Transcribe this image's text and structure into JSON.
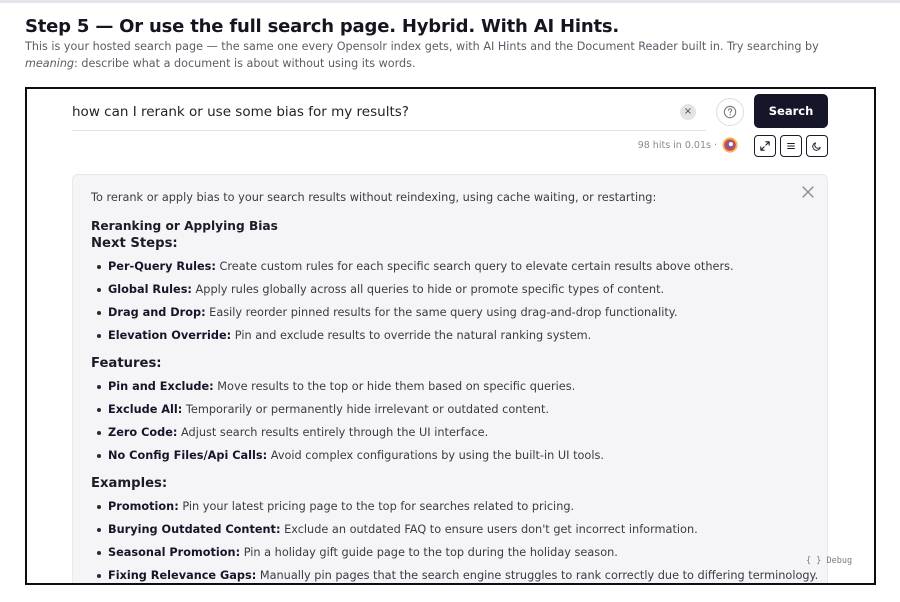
{
  "step": {
    "title": "Step 5 — Or use the full search page. Hybrid. With AI Hints.",
    "desc_before": "This is your hosted search page — the same one every Opensolr index gets, with AI Hints and the Document Reader built in. Try searching by ",
    "desc_em": "meaning",
    "desc_after": ": describe what a document is about without using its words."
  },
  "search": {
    "query": "how can I rerank or use some bias for my results?",
    "clear_icon": "×",
    "help_icon": "help-circle",
    "button_label": "Search",
    "hits_text": "98 hits in 0.01s ·"
  },
  "toolbar": {
    "expand_icon": "expand",
    "list_icon": "list",
    "theme_icon": "moon"
  },
  "ai_hint": {
    "intro": "To rerank or apply bias to your search results without reindexing, using cache waiting, or restarting:",
    "title": "Reranking or Applying Bias",
    "sections": [
      {
        "heading": "Next Steps:",
        "items": [
          {
            "term": "Per-Query Rules:",
            "text": " Create custom rules for each specific search query to elevate certain results above others."
          },
          {
            "term": "Global Rules:",
            "text": " Apply rules globally across all queries to hide or promote specific types of content."
          },
          {
            "term": "Drag and Drop:",
            "text": " Easily reorder pinned results for the same query using drag-and-drop functionality."
          },
          {
            "term": "Elevation Override:",
            "text": " Pin and exclude results to override the natural ranking system."
          }
        ]
      },
      {
        "heading": "Features:",
        "items": [
          {
            "term": "Pin and Exclude:",
            "text": " Move results to the top or hide them based on specific queries."
          },
          {
            "term": "Exclude All:",
            "text": " Temporarily or permanently hide irrelevant or outdated content."
          },
          {
            "term": "Zero Code:",
            "text": " Adjust search results entirely through the UI interface."
          },
          {
            "term": "No Config Files/Api Calls:",
            "text": " Avoid complex configurations by using the built-in UI tools."
          }
        ]
      },
      {
        "heading": "Examples:",
        "items": [
          {
            "term": "Promotion:",
            "text": " Pin your latest pricing page to the top for searches related to pricing."
          },
          {
            "term": "Burying Outdated Content:",
            "text": " Exclude an outdated FAQ to ensure users don't get incorrect information."
          },
          {
            "term": "Seasonal Promotion:",
            "text": " Pin a holiday gift guide page to the top during the holiday season."
          },
          {
            "term": "Fixing Relevance Gaps:",
            "text": " Manually pin pages that the search engine struggles to rank correctly due to differing terminology."
          }
        ]
      }
    ],
    "close_icon": "close"
  },
  "debug": {
    "label": "{ } Debug"
  },
  "colors": {
    "primary": "#16162a",
    "panel_bg": "#f5f5f7",
    "frame_border": "#0d0d12"
  }
}
